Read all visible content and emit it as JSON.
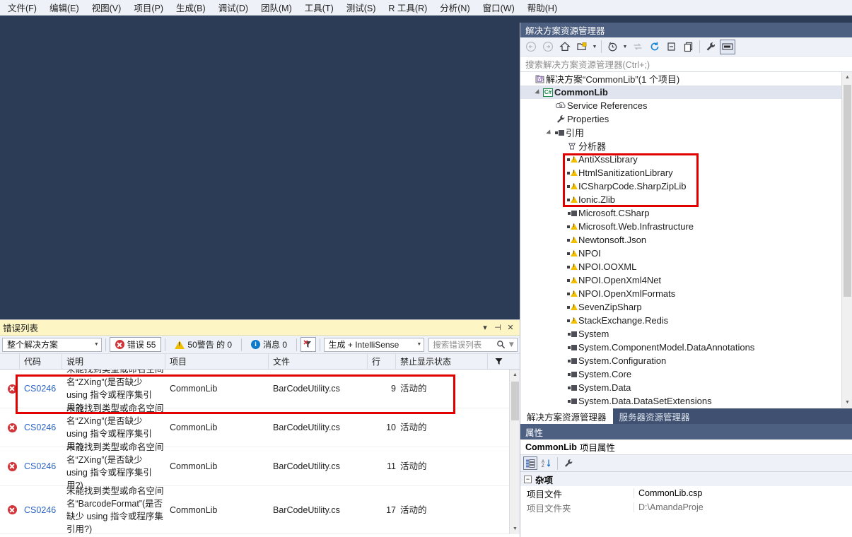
{
  "menu": {
    "items": [
      {
        "label": "文件(F)"
      },
      {
        "label": "编辑(E)"
      },
      {
        "label": "视图(V)"
      },
      {
        "label": "项目(P)"
      },
      {
        "label": "生成(B)"
      },
      {
        "label": "调试(D)"
      },
      {
        "label": "团队(M)"
      },
      {
        "label": "工具(T)"
      },
      {
        "label": "测试(S)"
      },
      {
        "label": "R 工具(R)"
      },
      {
        "label": "分析(N)"
      },
      {
        "label": "窗口(W)"
      },
      {
        "label": "帮助(H)"
      }
    ]
  },
  "error_list": {
    "title": "错误列表",
    "title_buttons": {
      "dropdown": "▾",
      "pin": "⊣",
      "close": "✕"
    },
    "toolbar": {
      "scope_value": "整个解决方案",
      "errors_label": "错误 55",
      "warnings_label": "50警告 的 0",
      "messages_label": "消息 0",
      "filter_icon": "error-filter-icon",
      "build_filter_value": "生成 + IntelliSense",
      "search_placeholder": "搜索错误列表",
      "search_icon": "magnifier-icon"
    },
    "columns": [
      {
        "label": "",
        "key": "icon"
      },
      {
        "label": "代码",
        "key": "code"
      },
      {
        "label": "说明",
        "key": "desc"
      },
      {
        "label": "项目",
        "key": "project"
      },
      {
        "label": "文件",
        "key": "file"
      },
      {
        "label": "行",
        "key": "line"
      },
      {
        "label": "禁止显示状态",
        "key": "state"
      }
    ],
    "rows": [
      {
        "severity": "error",
        "code": "CS0246",
        "desc": "未能找到类型或命名空间名“ZXing”(是否缺少 using 指令或程序集引用?)",
        "project": "CommonLib",
        "file": "BarCodeUtility.cs",
        "line": "9",
        "state": "活动的",
        "highlighted": true
      },
      {
        "severity": "error",
        "code": "CS0246",
        "desc": "未能找到类型或命名空间名“ZXing”(是否缺少 using 指令或程序集引用?)",
        "project": "CommonLib",
        "file": "BarCodeUtility.cs",
        "line": "10",
        "state": "活动的",
        "highlighted": false
      },
      {
        "severity": "error",
        "code": "CS0246",
        "desc": "未能找到类型或命名空间名“ZXing”(是否缺少 using 指令或程序集引用?)",
        "project": "CommonLib",
        "file": "BarCodeUtility.cs",
        "line": "11",
        "state": "活动的",
        "highlighted": false
      },
      {
        "severity": "error",
        "code": "CS0246",
        "desc": "未能找到类型或命名空间名“BarcodeFormat”(是否缺少 using 指令或程序集引用?)",
        "project": "CommonLib",
        "file": "BarCodeUtility.cs",
        "line": "17",
        "state": "活动的",
        "highlighted": false
      }
    ]
  },
  "solution_explorer": {
    "title": "解决方案资源管理器",
    "search_placeholder": "搜索解决方案资源管理器(Ctrl+;)",
    "toolbar_icons": [
      "back-arrow-icon",
      "forward-arrow-icon",
      "home-icon",
      "new-folder-icon",
      "dropdown-caret-icon",
      "pending-changes-icon",
      "dropdown-caret-icon",
      "sync-with-active-document-icon",
      "refresh-icon",
      "collapse-all-icon",
      "show-all-files-icon",
      "properties-wrench-icon",
      "preview-selected-items-icon"
    ],
    "tree": [
      {
        "label": "解决方案“CommonLib”(1 个项目)",
        "indent": 0,
        "icon": "solution-icon",
        "twisty": "none",
        "selected": false
      },
      {
        "label": "CommonLib",
        "indent": 1,
        "icon": "csharp-project-icon",
        "twisty": "open",
        "selected": true
      },
      {
        "label": "Service References",
        "indent": 2,
        "icon": "service-references-icon",
        "twisty": "none",
        "selected": false
      },
      {
        "label": "Properties",
        "indent": 2,
        "icon": "properties-wrench-icon",
        "twisty": "none",
        "selected": false
      },
      {
        "label": "引用",
        "indent": 2,
        "icon": "references-icon",
        "twisty": "open",
        "selected": false
      },
      {
        "label": "分析器",
        "indent": 3,
        "icon": "analyzers-icon",
        "twisty": "none",
        "selected": false
      },
      {
        "label": "AntiXssLibrary",
        "indent": 3,
        "icon": "reference-warning-icon",
        "twisty": "none",
        "selected": false
      },
      {
        "label": "HtmlSanitizationLibrary",
        "indent": 3,
        "icon": "reference-warning-icon",
        "twisty": "none",
        "selected": false
      },
      {
        "label": "ICSharpCode.SharpZipLib",
        "indent": 3,
        "icon": "reference-warning-icon",
        "twisty": "none",
        "selected": false
      },
      {
        "label": "Ionic.Zlib",
        "indent": 3,
        "icon": "reference-warning-icon",
        "twisty": "none",
        "selected": false
      },
      {
        "label": "Microsoft.CSharp",
        "indent": 3,
        "icon": "reference-icon",
        "twisty": "none",
        "selected": false
      },
      {
        "label": "Microsoft.Web.Infrastructure",
        "indent": 3,
        "icon": "reference-warning-icon",
        "twisty": "none",
        "selected": false
      },
      {
        "label": "Newtonsoft.Json",
        "indent": 3,
        "icon": "reference-warning-icon",
        "twisty": "none",
        "selected": false
      },
      {
        "label": "NPOI",
        "indent": 3,
        "icon": "reference-warning-icon",
        "twisty": "none",
        "selected": false
      },
      {
        "label": "NPOI.OOXML",
        "indent": 3,
        "icon": "reference-warning-icon",
        "twisty": "none",
        "selected": false
      },
      {
        "label": "NPOI.OpenXml4Net",
        "indent": 3,
        "icon": "reference-warning-icon",
        "twisty": "none",
        "selected": false
      },
      {
        "label": "NPOI.OpenXmlFormats",
        "indent": 3,
        "icon": "reference-warning-icon",
        "twisty": "none",
        "selected": false
      },
      {
        "label": "SevenZipSharp",
        "indent": 3,
        "icon": "reference-warning-icon",
        "twisty": "none",
        "selected": false
      },
      {
        "label": "StackExchange.Redis",
        "indent": 3,
        "icon": "reference-warning-icon",
        "twisty": "none",
        "selected": false
      },
      {
        "label": "System",
        "indent": 3,
        "icon": "reference-icon",
        "twisty": "none",
        "selected": false
      },
      {
        "label": "System.ComponentModel.DataAnnotations",
        "indent": 3,
        "icon": "reference-icon",
        "twisty": "none",
        "selected": false
      },
      {
        "label": "System.Configuration",
        "indent": 3,
        "icon": "reference-icon",
        "twisty": "none",
        "selected": false
      },
      {
        "label": "System.Core",
        "indent": 3,
        "icon": "reference-icon",
        "twisty": "none",
        "selected": false
      },
      {
        "label": "System.Data",
        "indent": 3,
        "icon": "reference-icon",
        "twisty": "none",
        "selected": false
      },
      {
        "label": "System.Data.DataSetExtensions",
        "indent": 3,
        "icon": "reference-icon",
        "twisty": "none",
        "selected": false
      }
    ],
    "highlight_box": {
      "from_label": "AntiXssLibrary",
      "to_label": "Ionic.Zlib",
      "color": "#e00000"
    }
  },
  "bottom_tabs": [
    {
      "label": "解决方案资源管理器",
      "active": true
    },
    {
      "label": "服务器资源管理器",
      "active": false
    }
  ],
  "properties": {
    "title": "属性",
    "object_name": "CommonLib",
    "object_kind": "项目属性",
    "toolbar_icons": [
      "categorized-icon",
      "alphabetical-sort-icon",
      "property-pages-wrench-icon"
    ],
    "group": "杂项",
    "rows": [
      {
        "key": "项目文件",
        "value": "CommonLib.csp",
        "dim": false
      },
      {
        "key": "项目文件夹",
        "value": "D:\\AmandaProje",
        "dim": true
      }
    ]
  },
  "colors": {
    "editor_bg": "#2d3c56",
    "panel_title_bg": "#4d6082",
    "errorlist_title_bg": "#fdf6c4",
    "accent_red": "#d13438",
    "annotation_red": "#e00000",
    "link_blue": "#2a62c4"
  }
}
